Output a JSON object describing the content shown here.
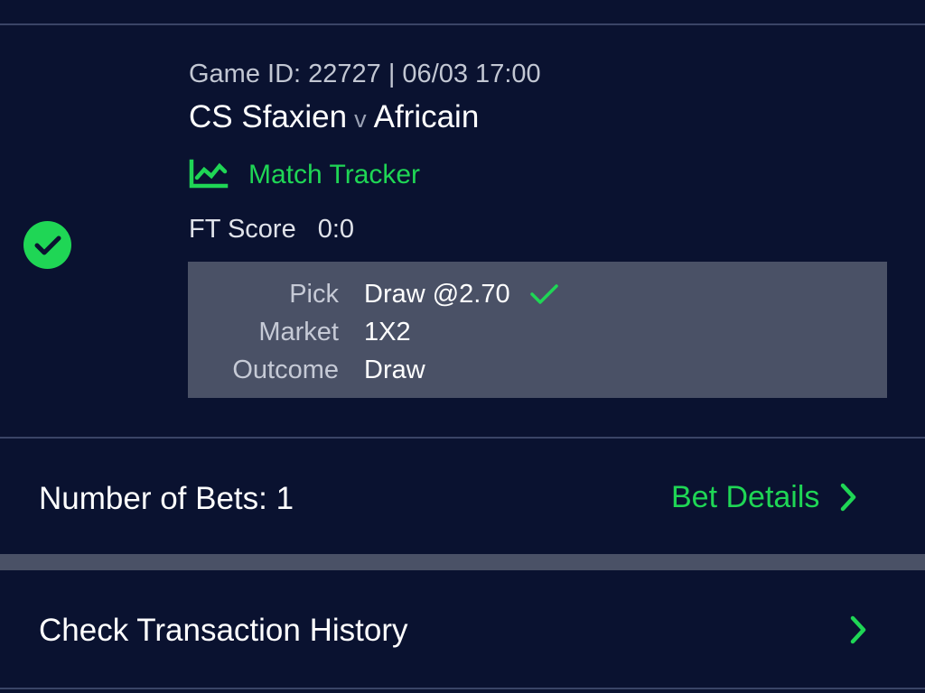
{
  "bet": {
    "game_meta": "Game ID: 22727 | 06/03 17:00",
    "home_team": "CS Sfaxien",
    "vs": "v",
    "away_team": "Africain",
    "tracker_label": "Match Tracker",
    "ft_score_label": "FT Score",
    "ft_score_value": "0:0",
    "status_icon": "check-circle-icon",
    "pick": {
      "pick_label": "Pick",
      "pick_value": "Draw @2.70",
      "market_label": "Market",
      "market_value": "1X2",
      "outcome_label": "Outcome",
      "outcome_value": "Draw"
    }
  },
  "summary": {
    "bets_count": "Number of Bets: 1",
    "bet_details_label": "Bet Details"
  },
  "history": {
    "label": "Check Transaction History"
  },
  "colors": {
    "background": "#0a1230",
    "accent_green": "#1fd655",
    "panel": "#4a5166",
    "divider": "#3a4466"
  }
}
